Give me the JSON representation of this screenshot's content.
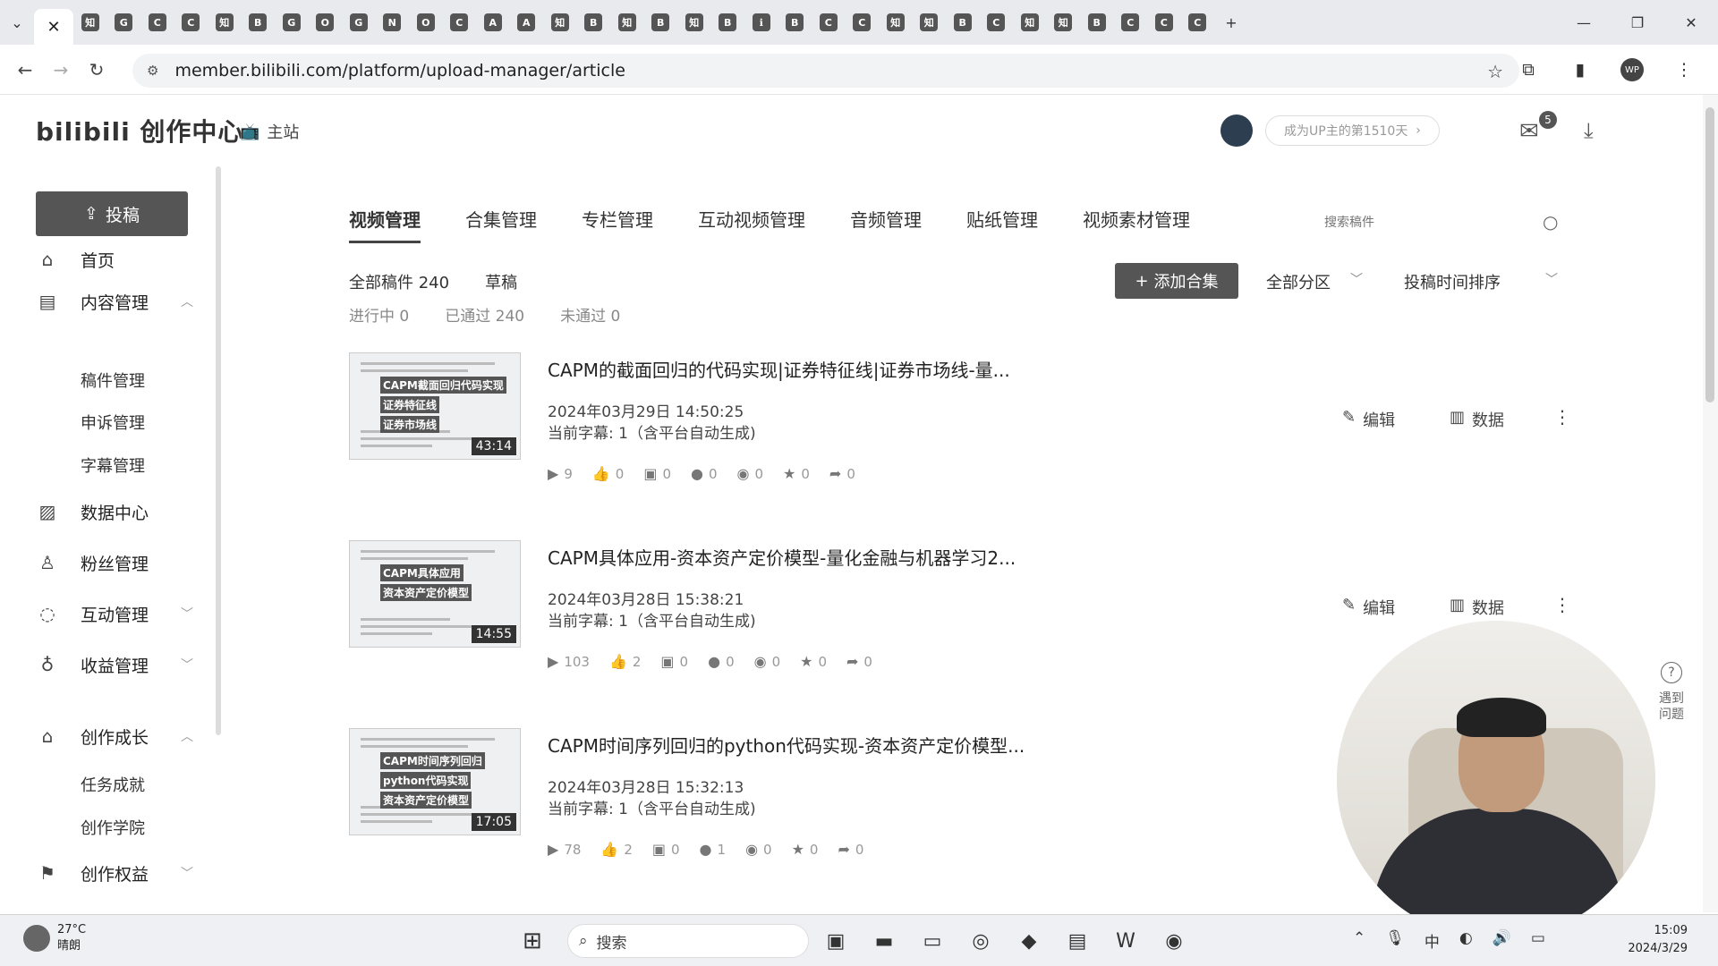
{
  "browser": {
    "url": "member.bilibili.com/platform/upload-manager/article",
    "profile_initials": "WP",
    "favicons": [
      "知",
      "G",
      "C",
      "C",
      "知",
      "B",
      "G",
      "O",
      "G",
      "N",
      "O",
      "C",
      "A",
      "A",
      "知",
      "B",
      "知",
      "B",
      "知",
      "B",
      "ℹ",
      "B",
      "C",
      "C",
      "知",
      "知",
      "B",
      "C",
      "知",
      "知",
      "B",
      "C",
      "C",
      "C"
    ]
  },
  "header": {
    "logo": "bilibili 创作中心",
    "main_site": "主站",
    "up_days": "成为UP主的第1510天",
    "mail_count": "5"
  },
  "sidebar": {
    "upload": "投稿",
    "items": [
      {
        "label": "首页",
        "icon": "home-icon"
      },
      {
        "label": "内容管理",
        "icon": "content-icon"
      },
      {
        "label": "数据中心",
        "icon": "chart-icon"
      },
      {
        "label": "粉丝管理",
        "icon": "user-icon"
      },
      {
        "label": "互动管理",
        "icon": "chat-icon"
      },
      {
        "label": "收益管理",
        "icon": "money-icon"
      },
      {
        "label": "创作成长",
        "icon": "growth-icon"
      },
      {
        "label": "创作权益",
        "icon": "flag-icon"
      }
    ],
    "content_sub": [
      "稿件管理",
      "申诉管理",
      "字幕管理"
    ],
    "growth_sub": [
      "任务成就",
      "创作学院"
    ]
  },
  "tabs": [
    "视频管理",
    "合集管理",
    "专栏管理",
    "互动视频管理",
    "音频管理",
    "贴纸管理",
    "视频素材管理"
  ],
  "search": {
    "placeholder": "搜索稿件"
  },
  "filters": {
    "all": "全部稿件 240",
    "draft": "草稿",
    "in_progress": "进行中 0",
    "passed": "已通过 240",
    "failed": "未通过 0",
    "add_collection": "添加合集",
    "zone": "全部分区",
    "sort": "投稿时间排序"
  },
  "actions": {
    "edit": "编辑",
    "data": "数据"
  },
  "videos": [
    {
      "title": "CAPM的截面回归的代码实现|证券特征线|证券市场线-量...",
      "date": "2024年03月29日 14:50:25",
      "subtitle": "当前字幕: 1（含平台自动生成)",
      "duration": "43:14",
      "thumb_lines": [
        "CAPM截面回归代码实现",
        "证券特征线",
        "证券市场线"
      ],
      "stats": {
        "play": "9",
        "like": "0",
        "danmaku": "0",
        "comment": "0",
        "coin": "0",
        "fav": "0",
        "share": "0"
      }
    },
    {
      "title": "CAPM具体应用-资本资产定价模型-量化金融与机器学习2...",
      "date": "2024年03月28日 15:38:21",
      "subtitle": "当前字幕: 1（含平台自动生成)",
      "duration": "14:55",
      "thumb_lines": [
        "CAPM具体应用",
        "资本资产定价模型"
      ],
      "stats": {
        "play": "103",
        "like": "2",
        "danmaku": "0",
        "comment": "0",
        "coin": "0",
        "fav": "0",
        "share": "0"
      }
    },
    {
      "title": "CAPM时间序列回归的python代码实现-资本资产定价模型...",
      "date": "2024年03月28日 15:32:13",
      "subtitle": "当前字幕: 1（含平台自动生成)",
      "duration": "17:05",
      "thumb_lines": [
        "CAPM时间序列回归",
        "python代码实现",
        "资本资产定价模型"
      ],
      "stats": {
        "play": "78",
        "like": "2",
        "danmaku": "0",
        "comment": "1",
        "coin": "0",
        "fav": "0",
        "share": "0"
      }
    }
  ],
  "help": {
    "label": "遇到问题"
  },
  "taskbar": {
    "temp": "27°C",
    "weather": "晴朗",
    "search": "搜索",
    "time": "15:09",
    "date": "2024/3/29"
  }
}
